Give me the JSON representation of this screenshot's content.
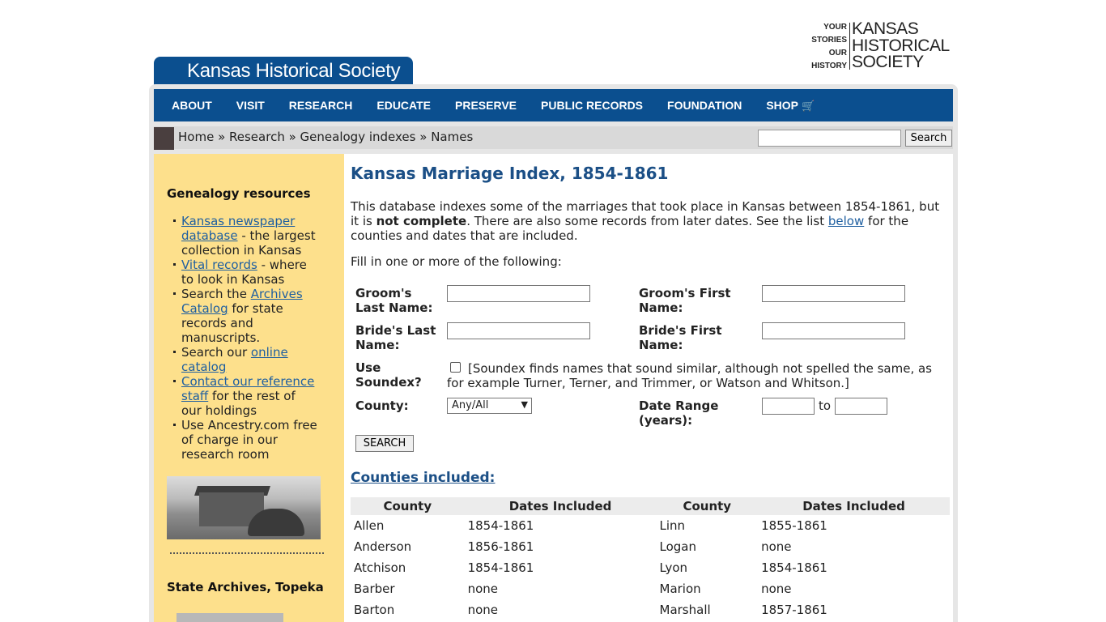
{
  "header": {
    "site_title": "Kansas Historical Society",
    "logo_left": [
      "YOUR",
      "STORIES",
      "OUR",
      "HISTORY"
    ],
    "logo_right": [
      "KANSAS",
      "HISTORICAL",
      "SOCIETY"
    ]
  },
  "nav": [
    "ABOUT",
    "VISIT",
    "RESEARCH",
    "EDUCATE",
    "PRESERVE",
    "PUBLIC RECORDS",
    "FOUNDATION",
    "SHOP"
  ],
  "breadcrumb": {
    "items": [
      "Home",
      "Research",
      "Genealogy indexes",
      "Names"
    ],
    "sep": " » "
  },
  "search": {
    "button": "Search",
    "value": ""
  },
  "sidebar": {
    "heading": "Genealogy resources",
    "items": [
      {
        "link": "Kansas newspaper database",
        "text": " - the largest collection in Kansas"
      },
      {
        "link": "Vital records",
        "text": " - where to look in Kansas"
      },
      {
        "pre": "Search the ",
        "link": "Archives Catalog",
        "text": " for state records and manuscripts."
      },
      {
        "pre": "Search our ",
        "link": "online catalog",
        "text": ""
      },
      {
        "link": "Contact our reference staff",
        "text": "  for the rest of our holdings"
      },
      {
        "pre": "Use Ancestry.com free of charge in our research room",
        "link": "",
        "text": ""
      }
    ],
    "heading2": "State Archives, Topeka"
  },
  "main": {
    "title": "Kansas Marriage Index, 1854-1861",
    "intro_1": "This database indexes some of the marriages that took place in Kansas between 1854-1861, but it is ",
    "intro_bold": "not complete",
    "intro_2": ". There are also some records from later dates. See the list ",
    "intro_link": "below",
    "intro_3": " for the counties and dates that are included.",
    "fill": "Fill in one or more of the following:",
    "form": {
      "groom_last": "Groom's Last Name:",
      "groom_first": "Groom's First Name:",
      "bride_last": "Bride's Last Name:",
      "bride_first": "Bride's First Name:",
      "soundex": "Use Soundex?",
      "soundex_note": "[Soundex finds names that sound similar, although not spelled the same, as for example Turner, Terner, and Trimmer, or Watson and Whitson.]",
      "county": "County:",
      "county_selected": "Any/All",
      "date_range": "Date Range (years):",
      "to": "to",
      "search": "SEARCH"
    },
    "counties_heading": "Counties included:",
    "table": {
      "headers": [
        "County",
        "Dates Included",
        "County",
        "Dates Included"
      ],
      "rows": [
        [
          "Allen",
          "1854-1861",
          "Linn",
          "1855-1861"
        ],
        [
          "Anderson",
          "1856-1861",
          "Logan",
          "none"
        ],
        [
          "Atchison",
          "1854-1861",
          "Lyon",
          "1854-1861"
        ],
        [
          "Barber",
          "none",
          "Marion",
          "none"
        ],
        [
          "Barton",
          "none",
          "Marshall",
          "1857-1861"
        ]
      ]
    }
  }
}
